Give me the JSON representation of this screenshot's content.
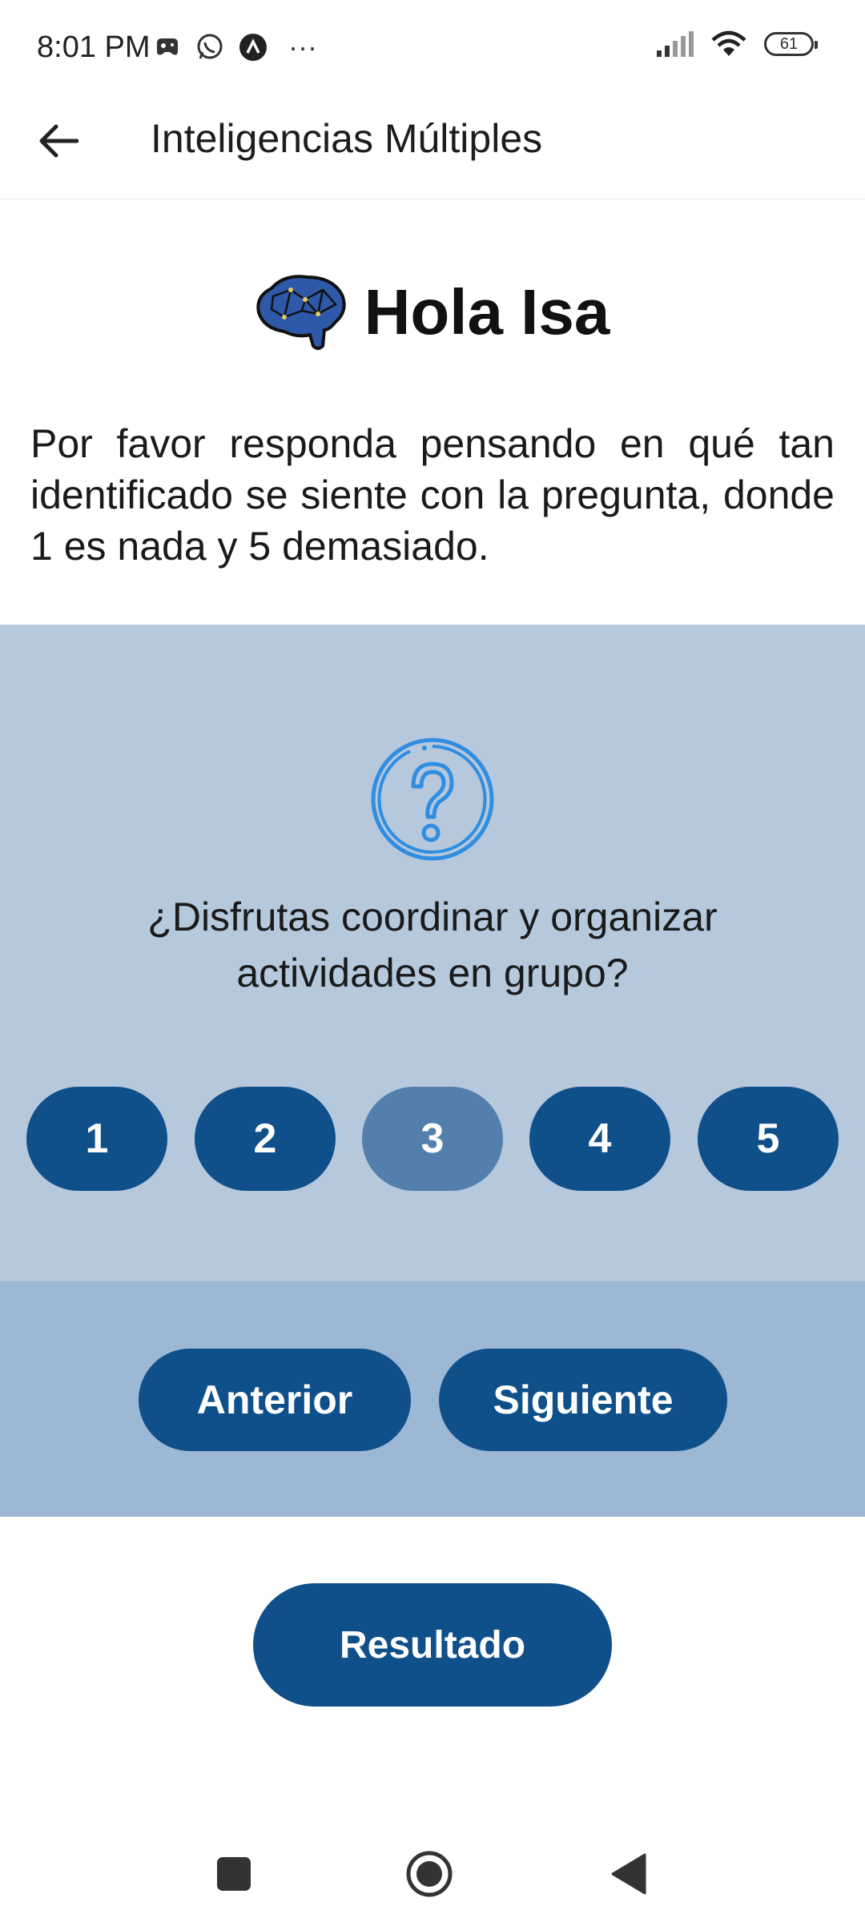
{
  "status_bar": {
    "time": "8:01 PM",
    "more": "···",
    "battery": "61",
    "left_icons": [
      "game-controller-icon",
      "whatsapp-icon",
      "app-icon"
    ],
    "right_icons": [
      "signal-icon",
      "wifi-icon",
      "battery-icon"
    ]
  },
  "app_bar": {
    "back_icon": "arrow-left-icon",
    "title": "Inteligencias Múltiples"
  },
  "greeting": {
    "icon": "brain-icon",
    "title": "Hola Isa",
    "instructions": "Por favor responda pensando en qué tan identificado se siente con la pregunta, donde 1 es nada y 5 demasiado."
  },
  "question": {
    "icon": "question-circle-icon",
    "text": "¿Disfrutas coordinar y organizar actividades en grupo?",
    "options": [
      "1",
      "2",
      "3",
      "4",
      "5"
    ],
    "selected": "3"
  },
  "navigation": {
    "previous_label": "Anterior",
    "next_label": "Siguiente"
  },
  "result": {
    "label": "Resultado"
  },
  "colors": {
    "primary": "#0f4f8a",
    "selected": "#527fab",
    "panel": "#b6c8dc",
    "nav_panel": "#9db8d4",
    "icon_blue": "#2f8ee0"
  }
}
